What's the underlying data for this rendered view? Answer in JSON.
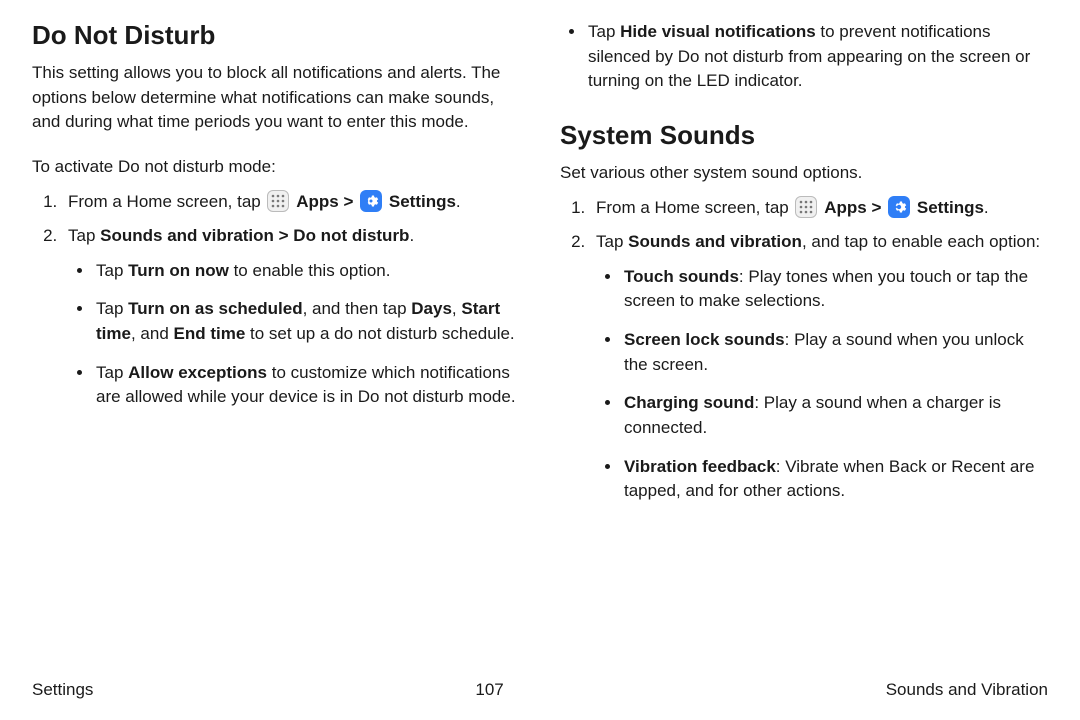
{
  "left": {
    "title": "Do Not Disturb",
    "intro": "This setting allows you to block all notifications and alerts. The options below determine what notifications can make sounds, and during what time periods you want to enter this mode.",
    "lead": "To activate Do not disturb mode:",
    "step1_pre": "From a Home screen, tap",
    "apps_label": "Apps",
    "settings_label": "Settings",
    "step2_pre": "Tap ",
    "step2_bold": "Sounds and vibration > Do not disturb",
    "step2_post": ".",
    "b1_pre": "Tap ",
    "b1_bold": "Turn on now",
    "b1_post": " to enable this option.",
    "b2_pre": "Tap ",
    "b2_bold1": "Turn on as scheduled",
    "b2_mid1": ", and then tap ",
    "b2_bold2": "Days",
    "b2_mid2": ", ",
    "b2_bold3": "Start time",
    "b2_mid3": ", and ",
    "b2_bold4": "End time",
    "b2_post": " to set up a do not disturb schedule.",
    "b3_pre": "Tap ",
    "b3_bold": "Allow exceptions",
    "b3_post": " to customize which notifications are allowed while your device is in Do not disturb mode."
  },
  "right": {
    "carry_pre": "Tap ",
    "carry_bold": "Hide visual notifications",
    "carry_post": " to prevent notifications silenced by Do not disturb from appearing on the screen or turning on the LED indicator.",
    "title": "System Sounds",
    "intro": "Set various other system sound options.",
    "step1_pre": "From a Home screen, tap",
    "apps_label": "Apps",
    "settings_label": "Settings",
    "step2_pre": "Tap ",
    "step2_bold": "Sounds and vibration",
    "step2_post": ", and tap to enable each option:",
    "opt1_bold": "Touch sounds",
    "opt1_post": ": Play tones when you touch or tap the screen to make selections.",
    "opt2_bold": "Screen lock sounds",
    "opt2_post": ": Play a sound when you unlock the screen.",
    "opt3_bold": "Charging sound",
    "opt3_post": ": Play a sound when a charger is connected.",
    "opt4_bold": "Vibration feedback",
    "opt4_post": ": Vibrate when Back or Recent are tapped, and for other actions."
  },
  "chevron": ">",
  "period": ".",
  "footer": {
    "left": "Settings",
    "center": "107",
    "right": "Sounds and Vibration"
  }
}
